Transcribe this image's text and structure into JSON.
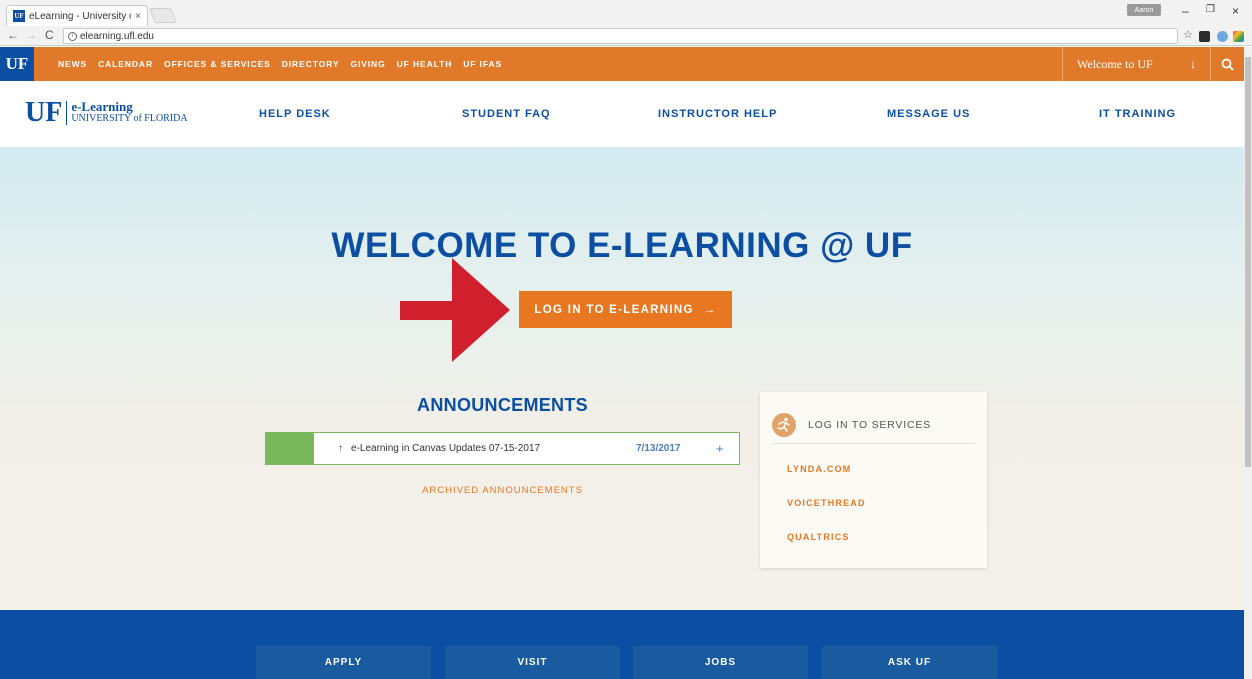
{
  "browser": {
    "tab_title": "eLearning - University of",
    "tab_close": "×",
    "profile_label": "Aaron",
    "url": "elearning.ufl.edu",
    "back": "←",
    "forward": "→",
    "reload": "C",
    "star": "☆",
    "window_min": "–",
    "window_restore": "❐",
    "window_close": "×",
    "extensions": [
      "pdf-icon",
      "cast-icon",
      "colorpicker-icon",
      "mail-icon",
      "opera-icon"
    ]
  },
  "uf_bar": {
    "logo": "UF",
    "items": [
      "NEWS",
      "CALENDAR",
      "OFFICES & SERVICES",
      "DIRECTORY",
      "GIVING",
      "UF HEALTH",
      "UF IFAS"
    ],
    "welcome": "Welcome to UF",
    "welcome_arrow": "↓",
    "search": "search-icon"
  },
  "header": {
    "logo_big": "UF",
    "logo_line1": "e-Learning",
    "logo_line2": "UNIVERSITY of FLORIDA",
    "nav": [
      "HELP DESK",
      "STUDENT FAQ",
      "INSTRUCTOR HELP",
      "MESSAGE US",
      "IT TRAINING"
    ]
  },
  "hero": {
    "title": "WELCOME TO E-LEARNING @ UF",
    "login_label": "LOG IN TO E-LEARNING",
    "login_arrow": "→"
  },
  "announcements": {
    "title": "ANNOUNCEMENTS",
    "items": [
      {
        "arrow": "↑",
        "text": "e-Learning in Canvas Updates 07-15-2017",
        "date": "7/13/2017",
        "expand": "+"
      }
    ],
    "archived_label": "ARCHIVED ANNOUNCEMENTS"
  },
  "services": {
    "title": "LOG IN TO SERVICES",
    "links": [
      "LYNDA.COM",
      "VOICETHREAD",
      "QUALTRICS"
    ]
  },
  "footer": {
    "buttons": [
      "APPLY",
      "VISIT",
      "JOBS",
      "ASK UF"
    ]
  },
  "colors": {
    "uf_orange": "#e07a2a",
    "uf_blue": "#0b4ea2",
    "annotation_arrow": "#d0202e",
    "announcement_green": "#7ab85d"
  }
}
